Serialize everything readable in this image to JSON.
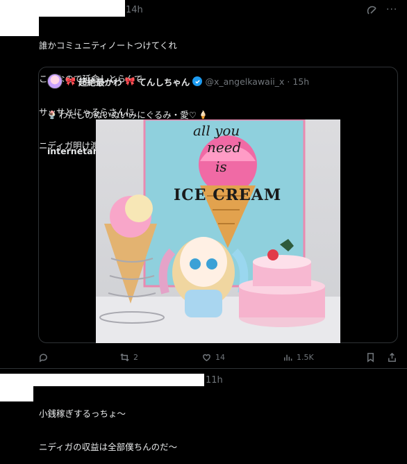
{
  "tweet1": {
    "time": "14h",
    "lines": [
      "誰かコミュニティノートつけてくれ",
      "こんなので延命しとらんで",
      "サッサとにゃるらさんに",
      "ニディガ明け渡してくれ"
    ]
  },
  "quote": {
    "display_name": "超絶最かわ",
    "display_name_suffix": "てんしちゃん",
    "handle": "@x_angelkawaii_x",
    "time": "· 15h",
    "text_line1": "わたしのぬいぬいみにぐるみ・愛♡",
    "text_line2": "internetangel.shop/items/686dd498...",
    "sign_words": [
      "all you",
      "need",
      "is",
      "ICE CREAM"
    ]
  },
  "actions": {
    "reply_count": "",
    "retweet_count": "2",
    "like_count": "14",
    "views_count": "1.5K"
  },
  "tweet2": {
    "time": "11h",
    "lines": [
      "小銭稼ぎするっちょ〜",
      "ニディガの収益は全部僕ちんのだ〜"
    ]
  },
  "colors": {
    "verified": "#1d9bf0",
    "muted": "#71767b",
    "border": "#2f3336"
  }
}
